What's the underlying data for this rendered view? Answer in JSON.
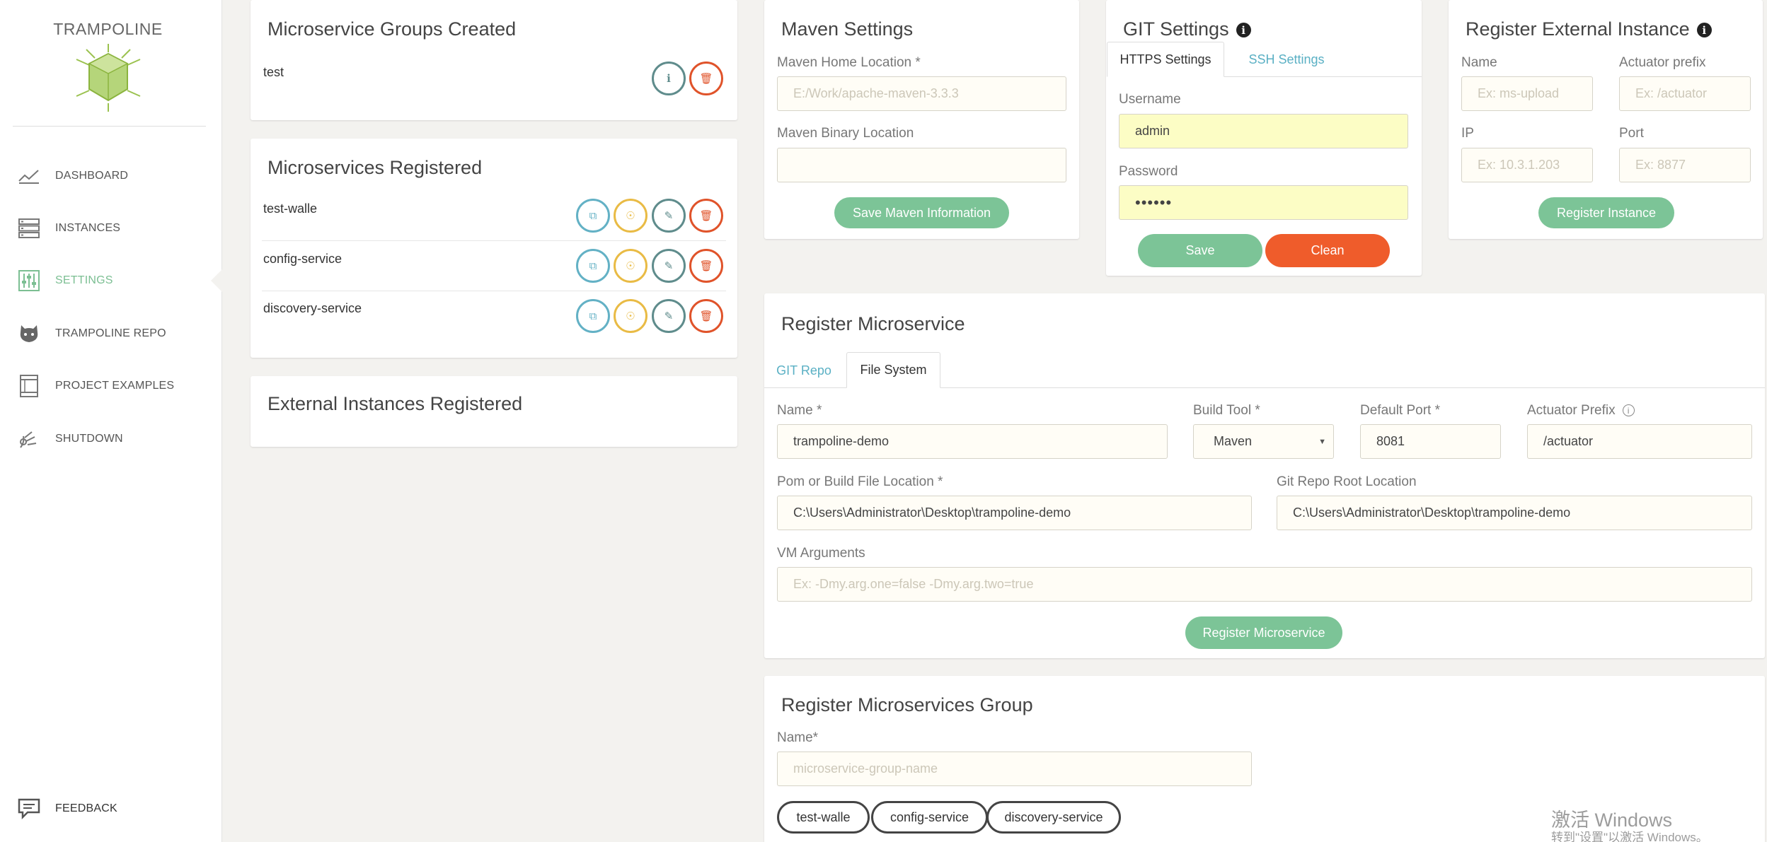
{
  "sidebar": {
    "brand": "TRAMPOLINE",
    "items": [
      {
        "label": "DASHBOARD",
        "icon": "chart-line-icon"
      },
      {
        "label": "INSTANCES",
        "icon": "list-icon"
      },
      {
        "label": "SETTINGS",
        "icon": "sliders-icon",
        "active": true
      },
      {
        "label": "TRAMPOLINE REPO",
        "icon": "github-icon"
      },
      {
        "label": "PROJECT EXAMPLES",
        "icon": "book-icon"
      },
      {
        "label": "SHUTDOWN",
        "icon": "shutdown-icon"
      }
    ],
    "feedback": "FEEDBACK"
  },
  "groups_created": {
    "title": "Microservice Groups Created",
    "rows": [
      {
        "name": "test"
      }
    ]
  },
  "registered": {
    "title": "Microservices Registered",
    "rows": [
      {
        "name": "test-walle"
      },
      {
        "name": "config-service"
      },
      {
        "name": "discovery-service"
      }
    ]
  },
  "external": {
    "title": "External Instances Registered"
  },
  "maven": {
    "title": "Maven Settings",
    "home_label": "Maven Home Location *",
    "home_placeholder": "E:/Work/apache-maven-3.3.3",
    "binary_label": "Maven Binary Location",
    "binary_value": "",
    "save_label": "Save Maven Information"
  },
  "git": {
    "title": "GIT Settings",
    "tab_https": "HTTPS Settings",
    "tab_ssh": "SSH Settings",
    "username_label": "Username",
    "username_value": "admin",
    "password_label": "Password",
    "password_value": "••••••",
    "save_label": "Save",
    "clean_label": "Clean"
  },
  "external_instance": {
    "title": "Register External Instance",
    "name_label": "Name",
    "name_placeholder": "Ex: ms-upload",
    "actuator_label": "Actuator prefix",
    "actuator_placeholder": "Ex: /actuator",
    "ip_label": "IP",
    "ip_placeholder": "Ex: 10.3.1.203",
    "port_label": "Port",
    "port_placeholder": "Ex: 8877",
    "submit_label": "Register Instance"
  },
  "register_ms": {
    "title": "Register Microservice",
    "tab_git": "GIT Repo",
    "tab_fs": "File System",
    "name_label": "Name *",
    "name_value": "trampoline-demo",
    "build_label": "Build Tool *",
    "build_value": "Maven",
    "port_label": "Default Port *",
    "port_value": "8081",
    "actuator_label": "Actuator Prefix",
    "actuator_value": "/actuator",
    "pom_label": "Pom or Build File Location *",
    "pom_value": "C:\\Users\\Administrator\\Desktop\\trampoline-demo",
    "gitroot_label": "Git Repo Root Location",
    "gitroot_value": "C:\\Users\\Administrator\\Desktop\\trampoline-demo",
    "vm_label": "VM Arguments",
    "vm_placeholder": "Ex: -Dmy.arg.one=false -Dmy.arg.two=true",
    "submit_label": "Register Microservice"
  },
  "register_group": {
    "title": "Register Microservices Group",
    "name_label": "Name*",
    "name_placeholder": "microservice-group-name",
    "pills": [
      "test-walle",
      "config-service",
      "discovery-service"
    ]
  },
  "watermark": {
    "line1": "激活 Windows",
    "line2": "转到\"设置\"以激活 Windows。"
  },
  "colors": {
    "accent_green": "#7cc497",
    "danger_orange": "#ef5c2b",
    "link_blue": "#5ab0c4"
  }
}
